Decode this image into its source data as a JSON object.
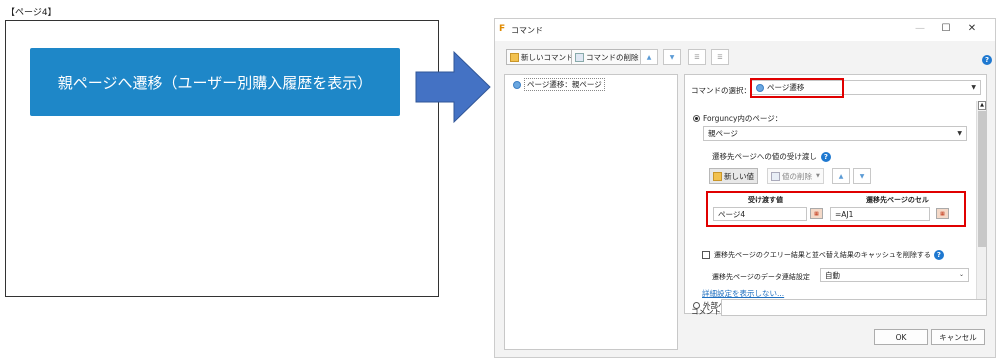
{
  "page": {
    "label": "【ページ4】",
    "nav_button_label": "親ページへ遷移（ユーザー別購入履歴を表示）"
  },
  "dialog": {
    "title": "コマンド",
    "toolbar": {
      "new_command": "新しいコマンド",
      "delete_command": "コマンドの削除"
    },
    "command_list": [
      "ページ遷移：親ページ"
    ],
    "command_select_label": "コマンドの選択：",
    "command_select_value": "ページ遷移",
    "internal_page_option": "Forguncy内のページ：",
    "internal_page_value": "親ページ",
    "pass_values_label": "遷移先ページへの値の受け渡し",
    "new_value_button": "新しい値",
    "delete_value_button": "値の削除",
    "table": {
      "headers": [
        "受け渡す値",
        "遷移先ページのセル"
      ],
      "rows": [
        [
          "ページ4",
          "=AJ1"
        ]
      ]
    },
    "clear_cache_label": "遷移先ページのクエリー結果と並べ替え結果のキャッシュを削除する",
    "data_link_label": "遷移先ページのデータ連結設定",
    "data_link_value": "自動",
    "hide_details_link": "詳細設定を表示しない...",
    "external_page_option": "外部ページ（アドレス指定）：",
    "comment_label": "コメント",
    "comment_value": "",
    "ok_label": "OK",
    "cancel_label": "キャンセル"
  },
  "colors": {
    "nav_button": "#1e87c8",
    "arrow": "#4472c4",
    "highlight": "#e00000"
  }
}
